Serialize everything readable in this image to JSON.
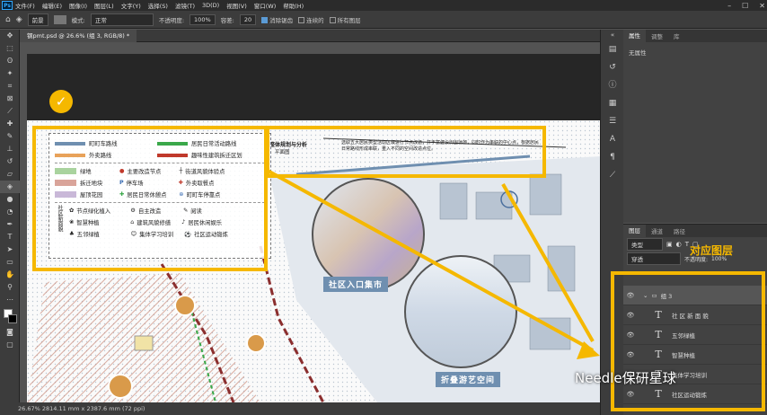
{
  "app": {
    "logo": "Ps"
  },
  "menu": [
    "文件(F)",
    "编辑(E)",
    "图像(I)",
    "图层(L)",
    "文字(Y)",
    "选择(S)",
    "滤镜(T)",
    "3D(D)",
    "视图(V)",
    "窗口(W)",
    "帮助(H)"
  ],
  "options": {
    "fill_source": "前景",
    "mode_label": "模式:",
    "mode_value": "正常",
    "opacity_label": "不透明度:",
    "opacity_value": "100%",
    "tolerance_label": "容差:",
    "tolerance_value": "20",
    "antialias_label": "消除锯齿",
    "contiguous_label": "连续的",
    "all_layers_label": "所有图层"
  },
  "document": {
    "tab_title": "钢pmt.psd @ 26.6% (组 3, RGB/8) *",
    "status": "26.67%    2814.11 mm x 2387.6 mm (72 ppi)"
  },
  "properties": {
    "tabs": [
      "属性",
      "调整",
      "库"
    ],
    "empty_text": "无属性"
  },
  "layers": {
    "tabs": [
      "图层",
      "通道",
      "路径"
    ],
    "filter_label": "类型",
    "blend": "穿透",
    "opacity_label": "不透明度:",
    "opacity_value": "100%",
    "items": [
      {
        "name": "组 3",
        "type": "group"
      },
      {
        "name": "社 区 新 面 貌",
        "type": "text"
      },
      {
        "name": "五邻绿植",
        "type": "text"
      },
      {
        "name": "智慧种植",
        "type": "text"
      },
      {
        "name": "集体学习培训",
        "type": "text"
      },
      {
        "name": "社区运动锻炼",
        "type": "text"
      }
    ]
  },
  "annotation": "对应图层",
  "watermark": "Needle保研星球",
  "map": {
    "title": "整体规划与分析",
    "subtitle": "平面图",
    "description": "选取五大居民类型活动区域进行节点改造，并丰富建设周围场地，同时作为串联的中心点，根据居民日常路线形成串联，重入不同的空间改造点位。",
    "label_market": "社区入口集市",
    "label_space": "折叠游艺空间",
    "legend": {
      "lines": [
        {
          "name": "町町车路线",
          "color": "#6f8fb0"
        },
        {
          "name": "居民日常活动路线",
          "color": "#3aa84a"
        },
        {
          "name": "外卖路线",
          "color": "#e8a25a"
        },
        {
          "name": "趣味性建筑拆迁区划",
          "color": "#c0392b"
        }
      ],
      "areas": [
        "绿地",
        "主要改造节点",
        "街道风貌体验点",
        "拆迁地块",
        "停车场",
        "外卖取餐点",
        "屋顶花园",
        "居民日常休憩点",
        "町町车停靠点"
      ],
      "renewal_title": "社区新面貌",
      "renewal": [
        "节点绿化植入",
        "自主改造",
        "阅读",
        "智慧种植",
        "建筑风貌修缮",
        "居民休闲娱乐",
        "五邻绿植",
        "集体学习培训",
        "社区运动锻炼"
      ]
    }
  }
}
